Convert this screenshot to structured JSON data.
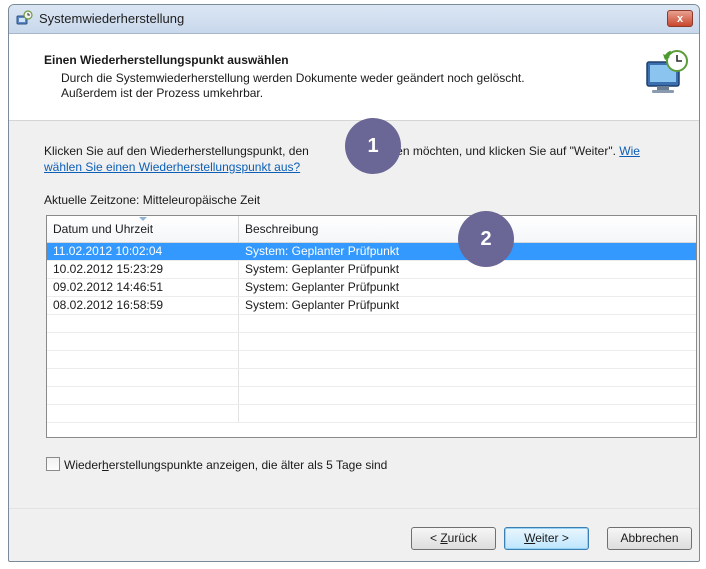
{
  "window": {
    "title": "Systemwiederherstellung",
    "close_label": "x"
  },
  "header": {
    "title": "Einen Wiederherstellungspunkt auswählen",
    "desc_line1": "Durch die Systemwiederherstellung werden Dokumente weder geändert noch gelöscht.",
    "desc_line2": "Außerdem ist der Prozess umkehrbar."
  },
  "instructions": {
    "text_before_badge": "Klicken Sie auf den Wiederherstellungspunkt, den",
    "text_after_badge": "en möchten, und klicken Sie auf \"Weiter\". ",
    "link_part1": "Wie",
    "link_part2": "wählen Sie einen Wiederherstellungspunkt aus?"
  },
  "timezone": "Aktuelle Zeitzone: Mitteleuropäische Zeit",
  "table": {
    "columns": [
      "Datum und Uhrzeit",
      "Beschreibung"
    ],
    "rows": [
      {
        "date": "11.02.2012 10:02:04",
        "desc": "System: Geplanter Prüfpunkt",
        "selected": true
      },
      {
        "date": "10.02.2012 15:23:29",
        "desc": "System: Geplanter Prüfpunkt",
        "selected": false
      },
      {
        "date": "09.02.2012 14:46:51",
        "desc": "System: Geplanter Prüfpunkt",
        "selected": false
      },
      {
        "date": "08.02.2012 16:58:59",
        "desc": "System: Geplanter Prüfpunkt",
        "selected": false
      }
    ],
    "selected_color": "#3399ff"
  },
  "checkbox": {
    "label_pre": "Wieder",
    "label_underlined": "h",
    "label_post": "erstellungspunkte anzeigen, die älter als 5 Tage sind",
    "checked": false
  },
  "buttons": {
    "back_pre": "< ",
    "back_underlined": "Z",
    "back_post": "urück",
    "next_underlined": "W",
    "next_post": "eiter >",
    "cancel": "Abbrechen"
  },
  "badges": {
    "one": "1",
    "two": "2",
    "color": "#6a6695"
  }
}
